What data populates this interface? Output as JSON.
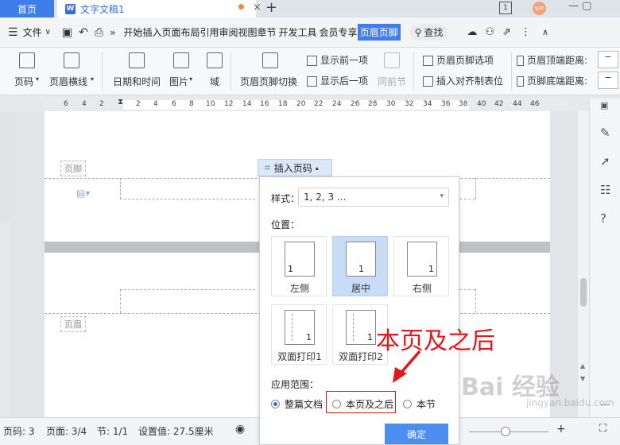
{
  "tabs": {
    "home": "首页",
    "doc": "文字文稿1",
    "doc_icon": "W"
  },
  "menu": {
    "file": "文件",
    "items": [
      "开始",
      "插入",
      "页面布局",
      "引用",
      "审阅",
      "视图",
      "章节",
      "开发工具",
      "会员专享"
    ],
    "active": "页眉页脚",
    "search": "查找"
  },
  "ribbon": {
    "page_number": "页码",
    "header_line": "页眉横线",
    "date_time": "日期和时间",
    "picture": "图片",
    "field": "域",
    "switch": "页眉页脚切换",
    "show_prev": "显示前一项",
    "show_next": "显示后一项",
    "same_as_prev": "同前节",
    "hf_options": "页眉页脚选项",
    "insert_align_tab": "插入对齐制表位",
    "header_top": "页眉顶端距离:",
    "footer_bottom": "页脚底端距离:"
  },
  "ruler_ticks": [
    "6",
    "4",
    "2",
    "2",
    "4",
    "6",
    "8",
    "10",
    "12",
    "14",
    "16",
    "18",
    "20",
    "22",
    "24",
    "26",
    "28",
    "30",
    "32",
    "34",
    "36",
    "38",
    "40",
    "42",
    "44",
    "46"
  ],
  "doc": {
    "footer_tag": "页脚",
    "header_tag": "页眉"
  },
  "insert_page_number": {
    "button": "插入页码",
    "style_label": "样式：",
    "style_value": "1, 2, 3 ...",
    "position_label": "位置：",
    "positions": [
      {
        "label": "左侧",
        "num": "1"
      },
      {
        "label": "居中",
        "num": "1"
      },
      {
        "label": "右侧",
        "num": "1"
      },
      {
        "label": "双面打印1",
        "num": "1"
      },
      {
        "label": "双面打印2",
        "num": "1"
      }
    ],
    "selected_position": "居中",
    "scope_label": "应用范围：",
    "scope_options": [
      "整篇文档",
      "本页及之后",
      "本节"
    ],
    "selected_scope": "整篇文档",
    "ok": "确定"
  },
  "annotation": "本页及之后",
  "status": {
    "page_no": "页码: 3",
    "page": "页面: 3/4",
    "section": "节: 1/1",
    "setting": "设置值: 27.5厘米"
  },
  "watermark": {
    "main": "Bai 经验",
    "sub": "jingyan.baidu.com"
  },
  "colors": {
    "accent": "#3f7ee8",
    "annotation": "#e0181c",
    "selected": "#c8dcf7"
  }
}
